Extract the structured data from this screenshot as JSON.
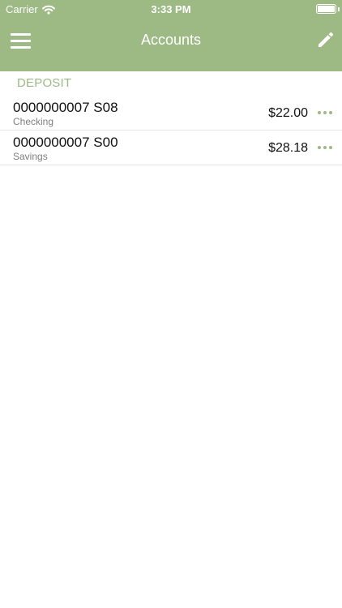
{
  "status_bar": {
    "carrier": "Carrier",
    "time": "3:33 PM"
  },
  "nav": {
    "title": "Accounts",
    "menu_icon": "hamburger-menu-icon",
    "edit_icon": "pencil-icon"
  },
  "section": {
    "title": "DEPOSIT"
  },
  "accounts": [
    {
      "number": "0000000007 S08",
      "type": "Checking",
      "balance": "$22.00"
    },
    {
      "number": "0000000007 S00",
      "type": "Savings",
      "balance": "$28.18"
    }
  ],
  "colors": {
    "accent": "#9dba85",
    "header_text": "#ffffff",
    "primary_text": "#111111",
    "secondary_text": "#7f7f7f",
    "divider": "#e5e5e5"
  }
}
